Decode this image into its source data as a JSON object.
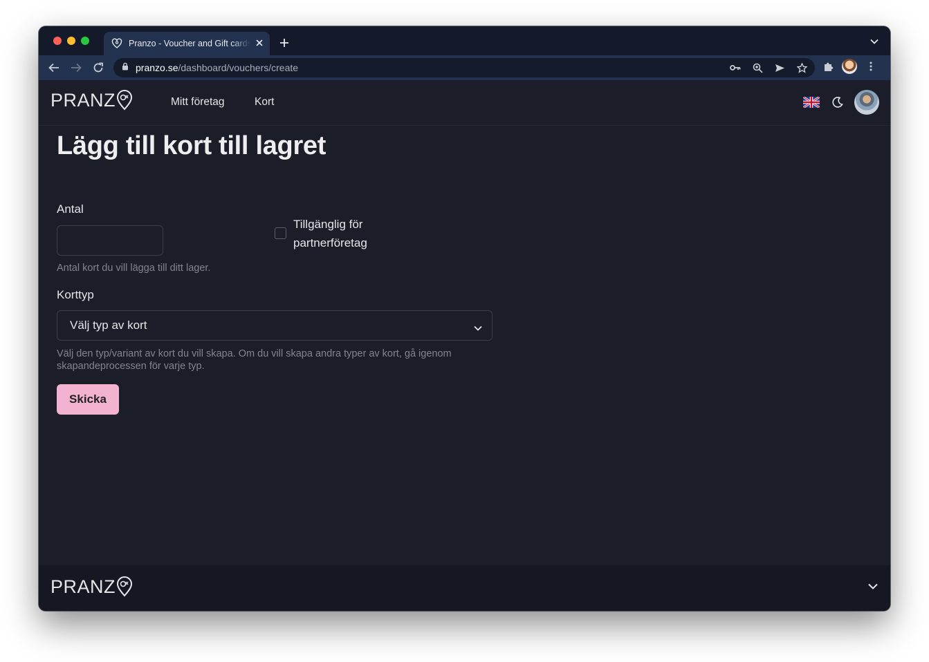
{
  "browser": {
    "tab_title": "Pranzo - Voucher and Gift cards",
    "url_host": "pranzo.se",
    "url_path": "/dashboard/vouchers/create"
  },
  "header": {
    "logo": "PRANZ",
    "nav": [
      "Mitt företag",
      "Kort"
    ]
  },
  "form": {
    "title": "Lägg till kort till lagret",
    "quantity_label": "Antal",
    "quantity_value": "",
    "quantity_help": "Antal kort du vill lägga till ditt lager.",
    "partner_checkbox_label": "Tillgänglig för partnerföretag",
    "partner_checked": false,
    "card_type_label": "Korttyp",
    "card_type_selected": "Välj typ av kort",
    "card_type_help": "Välj den typ/variant av kort du vill skapa. Om du vill skapa andra typer av kort, gå igenom skapandeprocessen för varje typ.",
    "submit_label": "Skicka"
  },
  "footer": {
    "logo": "PRANZ"
  },
  "colors": {
    "page_bg": "#1b1e28",
    "accent_button": "#f3b2cf",
    "tab_bar": "#141a29",
    "toolbar": "#22324f"
  },
  "icons": [
    "heart-location-favicon",
    "close-icon",
    "plus-icon",
    "chevron-down-icon",
    "back-arrow-icon",
    "forward-arrow-icon",
    "reload-icon",
    "lock-icon",
    "key-icon",
    "zoom-icon",
    "send-icon",
    "star-icon",
    "puzzle-icon",
    "kebab-menu-icon",
    "uk-flag-icon",
    "moon-icon",
    "location-pin-icon"
  ]
}
